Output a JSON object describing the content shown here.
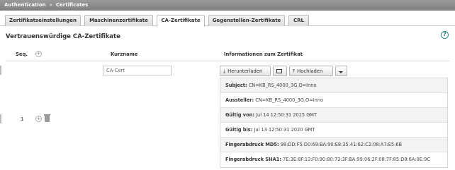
{
  "breadcrumb": {
    "root": "Authentication",
    "separator": "»",
    "current": "Certificates"
  },
  "tabs": [
    {
      "label": "Zertifikatseinstellungen",
      "active": false
    },
    {
      "label": "Maschinenzertifikate",
      "active": false
    },
    {
      "label": "CA-Zertifikate",
      "active": true
    },
    {
      "label": "Gegenstellen-Zertifikate",
      "active": false
    },
    {
      "label": "CRL",
      "active": false
    }
  ],
  "section": {
    "title": "Vertrauenswürdige CA-Zertifikate",
    "help_icon": "?"
  },
  "table": {
    "headers": {
      "seq": "Seq.",
      "shortname": "Kurzname",
      "info": "Informationen zum Zertifikat"
    },
    "row": {
      "seq": "1",
      "shortname_value": "CA-Cert",
      "buttons": {
        "download": "Herunterladen",
        "upload": "Hochladen"
      },
      "details": [
        {
          "label": "Subject:",
          "value": "CN=KB_RS_4000_3G,O=Inno"
        },
        {
          "label": "Aussteller:",
          "value": "CN=KB_RS_4000_3G,O=Inno"
        },
        {
          "label": "Gültig von:",
          "value": "Jul 14 12:50:31 2015 GMT"
        },
        {
          "label": "Gültig bis:",
          "value": "Jul 13 12:50:31 2020 GMT"
        },
        {
          "label": "Fingerabdruck MD5:",
          "value": "98:DD:F5:D0:69:BA:90:E8:35:41:62:C2:08:A7:E5:6B"
        },
        {
          "label": "Fingerabdruck SHA1:",
          "value": "7E:3E:8F:13:F0:90:80:73:3F:BA:99:06:2F:08:7F:85:D8:6A:0E:9C"
        }
      ]
    }
  }
}
